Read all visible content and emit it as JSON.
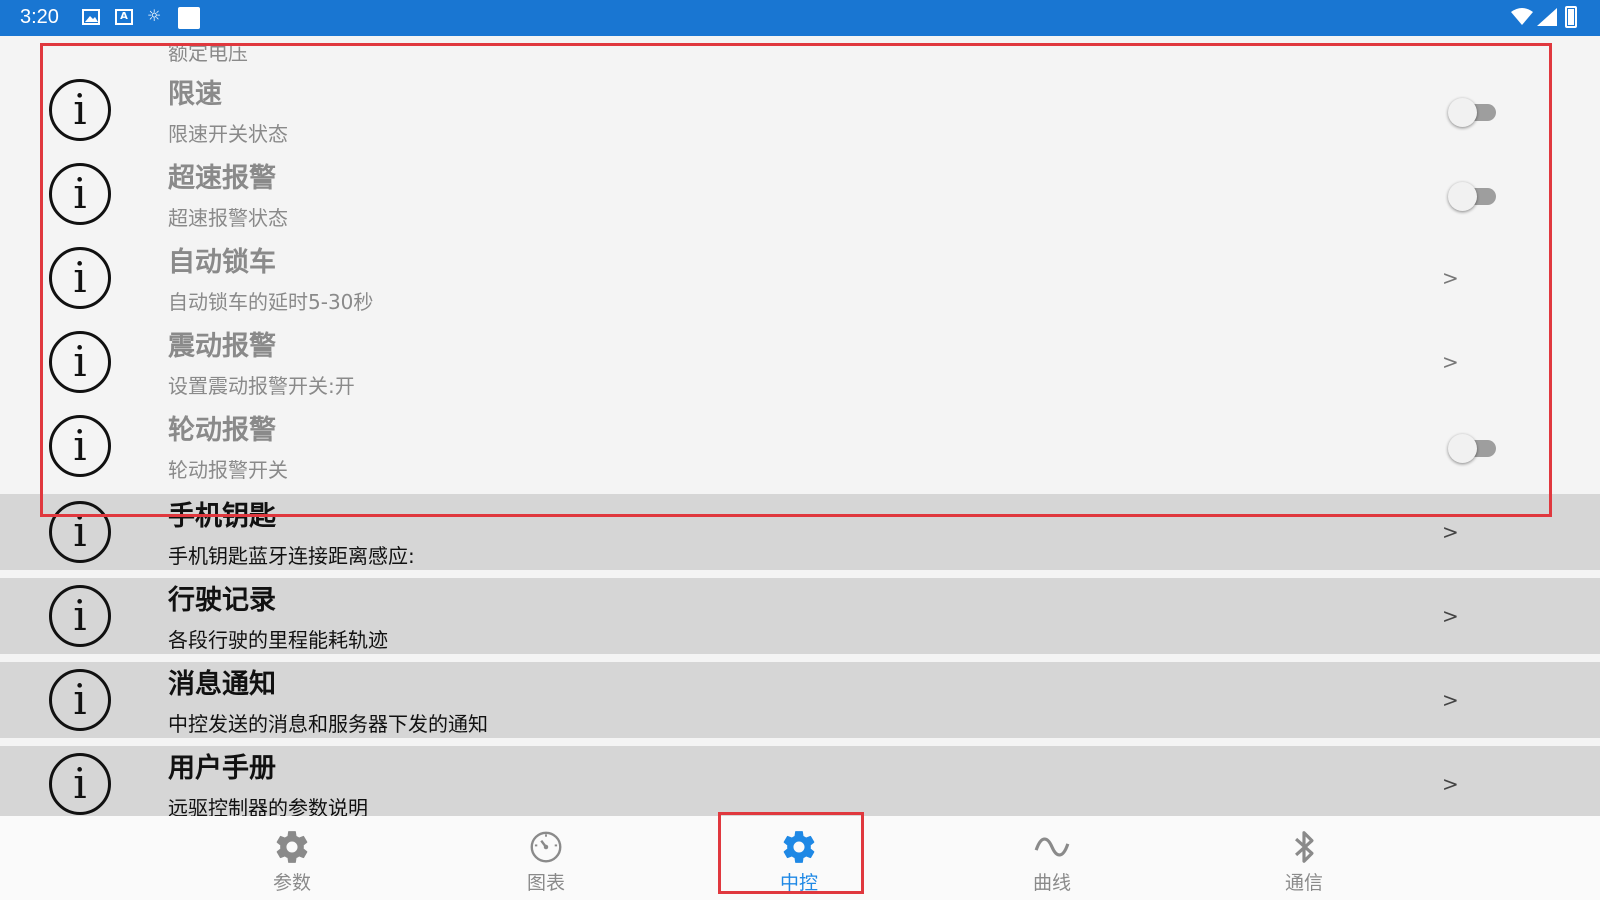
{
  "status_bar": {
    "time": "3:20",
    "notification_icons": [
      "image-icon",
      "a-icon",
      "brightness-icon",
      "blank-icon"
    ],
    "system_icons": [
      "wifi-icon",
      "signal-icon",
      "battery-icon"
    ]
  },
  "list": {
    "partial_row": {
      "subtitle": "额定电压"
    },
    "rows": [
      {
        "title": "限速",
        "subtitle": "限速开关状态",
        "control": "toggle",
        "checked": false
      },
      {
        "title": "超速报警",
        "subtitle": "超速报警状态",
        "control": "toggle",
        "checked": false
      },
      {
        "title": "自动锁车",
        "subtitle": "自动锁车的延时5-30秒",
        "control": "chevron",
        "chevron": ">"
      },
      {
        "title": "震动报警",
        "subtitle": "设置震动报警开关:开",
        "control": "chevron",
        "chevron": ">"
      },
      {
        "title": "轮动报警",
        "subtitle": "轮动报警开关",
        "control": "toggle",
        "checked": false
      },
      {
        "title": "手机钥匙",
        "subtitle": "手机钥匙蓝牙连接距离感应:",
        "control": "chevron",
        "chevron": ">"
      },
      {
        "title": "行驶记录",
        "subtitle": "各段行驶的里程能耗轨迹",
        "control": "chevron",
        "chevron": ">"
      },
      {
        "title": "消息通知",
        "subtitle": "中控发送的消息和服务器下发的通知",
        "control": "chevron",
        "chevron": ">"
      },
      {
        "title": "用户手册",
        "subtitle": "远驱控制器的参数说明",
        "control": "chevron",
        "chevron": ">"
      }
    ],
    "info_icon_glyph": "i"
  },
  "bottom_nav": {
    "tabs": [
      {
        "label": "参数",
        "icon": "gear-icon",
        "active": false
      },
      {
        "label": "图表",
        "icon": "gauge-icon",
        "active": false
      },
      {
        "label": "中控",
        "icon": "gear-icon",
        "active": true
      },
      {
        "label": "曲线",
        "icon": "wave-icon",
        "active": false
      },
      {
        "label": "通信",
        "icon": "bluetooth-icon",
        "active": false
      }
    ]
  },
  "colors": {
    "status_bar": "#1976d2",
    "active_tab": "#1e88e5",
    "highlight_box": "#e0383e",
    "row_grey": "#d6d6d6"
  }
}
